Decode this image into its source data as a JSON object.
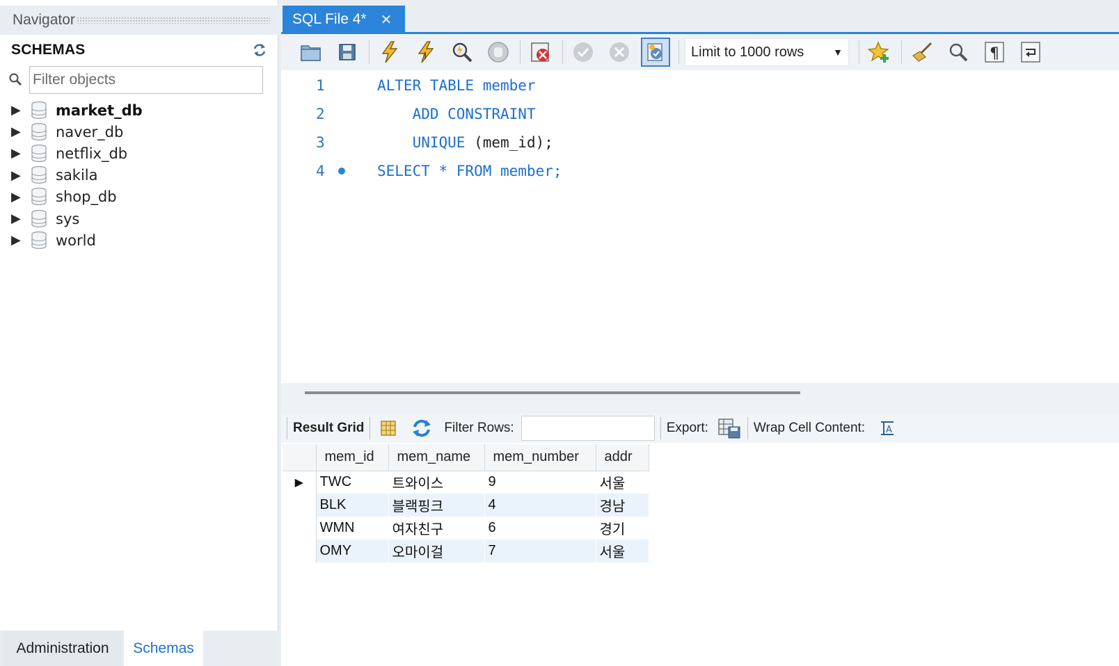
{
  "navigator": {
    "title": "Navigator",
    "schemas_label": "SCHEMAS",
    "filter_placeholder": "Filter objects",
    "schemas": [
      {
        "name": "market_db",
        "bold": true
      },
      {
        "name": "naver_db",
        "bold": false
      },
      {
        "name": "netflix_db",
        "bold": false
      },
      {
        "name": "sakila",
        "bold": false
      },
      {
        "name": "shop_db",
        "bold": false
      },
      {
        "name": "sys",
        "bold": false
      },
      {
        "name": "world",
        "bold": false
      }
    ],
    "tabs": {
      "administration": "Administration",
      "schemas": "Schemas"
    }
  },
  "editor": {
    "tab_title": "SQL File 4*",
    "limit_select": "Limit to 1000 rows",
    "lines": [
      {
        "num": "1",
        "indent": "",
        "kw": "ALTER TABLE member",
        "rest": ""
      },
      {
        "num": "2",
        "indent": "    ",
        "kw": "ADD CONSTRAINT",
        "rest": ""
      },
      {
        "num": "3",
        "indent": "    ",
        "kw": "UNIQUE",
        "rest": " (mem_id);"
      },
      {
        "num": "4",
        "indent": "",
        "kw": "SELECT * FROM member;",
        "rest": "",
        "marker": true
      }
    ]
  },
  "result": {
    "result_grid_label": "Result Grid",
    "filter_rows_label": "Filter Rows:",
    "export_label": "Export:",
    "wrap_label": "Wrap Cell Content:",
    "columns": [
      "mem_id",
      "mem_name",
      "mem_number",
      "addr"
    ],
    "rows": [
      [
        "TWC",
        "트와이스",
        "9",
        "서울"
      ],
      [
        "BLK",
        "블랙핑크",
        "4",
        "경남"
      ],
      [
        "WMN",
        "여자친구",
        "6",
        "경기"
      ],
      [
        "OMY",
        "오마이걸",
        "7",
        "서울"
      ]
    ]
  },
  "colors": {
    "accent": "#2b84d9",
    "keyword": "#1b6fd1",
    "alt_row": "#eaf2fb"
  }
}
